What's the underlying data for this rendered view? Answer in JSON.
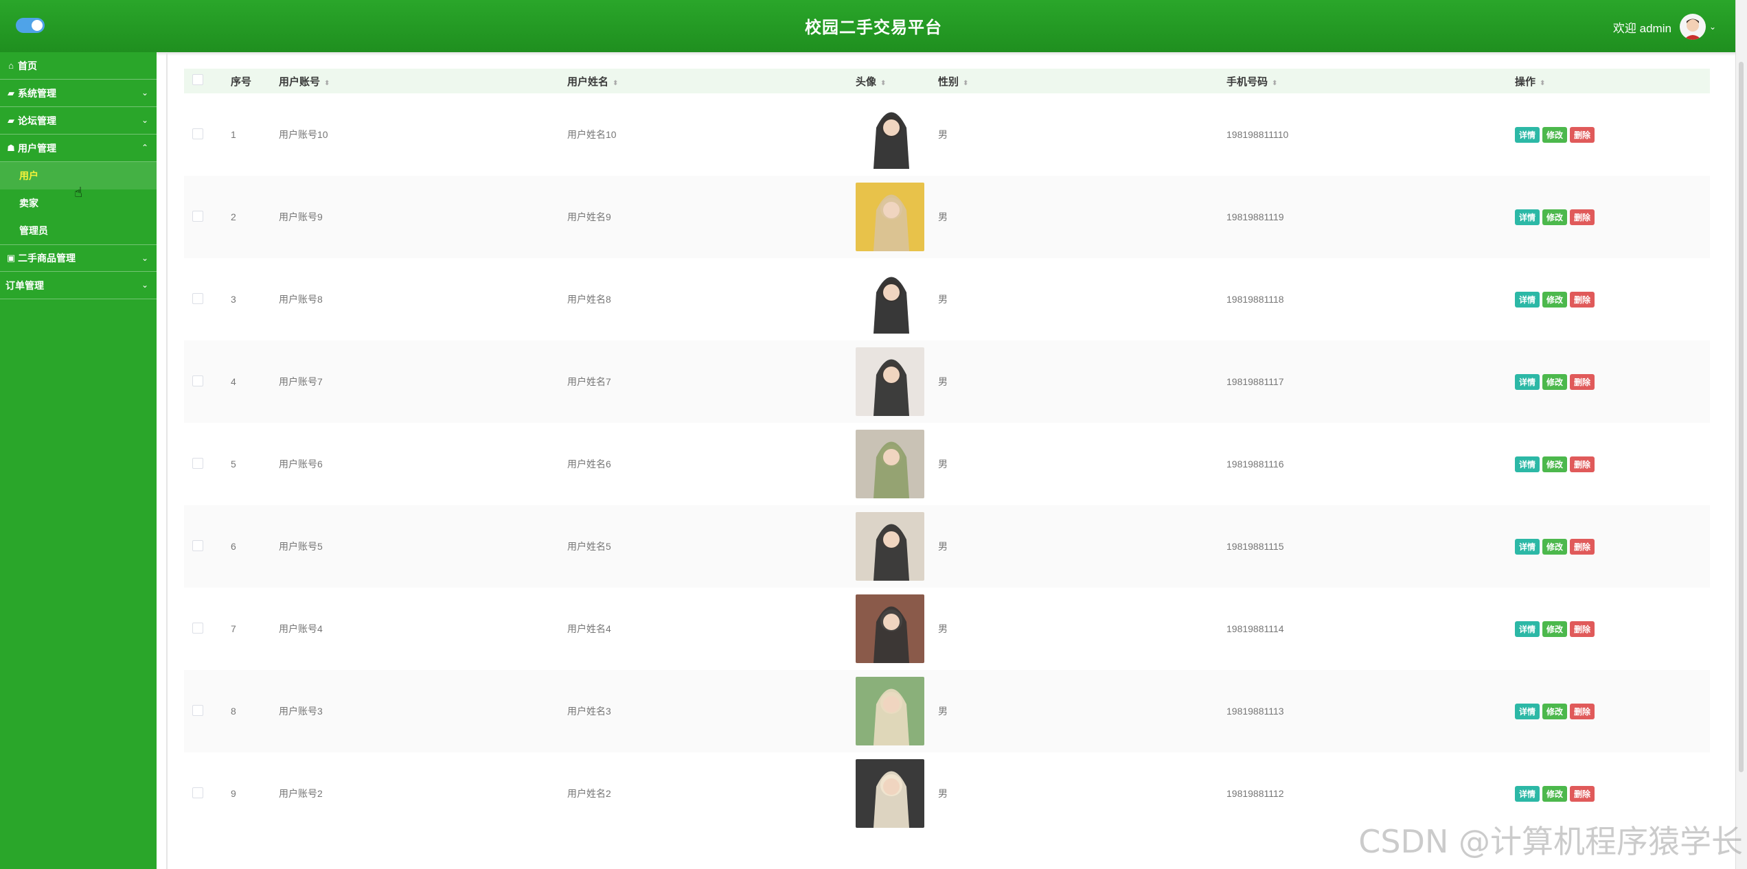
{
  "header": {
    "title": "校园二手交易平台",
    "welcome": "欢迎 admin"
  },
  "sidebar": {
    "items": [
      {
        "label": "首页",
        "icon": "home-icon",
        "expandable": false
      },
      {
        "label": "系统管理",
        "icon": "bank-icon",
        "expandable": true
      },
      {
        "label": "论坛管理",
        "icon": "bank-icon",
        "expandable": true
      },
      {
        "label": "用户管理",
        "icon": "user-icon",
        "expandable": true,
        "expanded": true
      }
    ],
    "sub_items": [
      {
        "label": "用户",
        "active": true
      },
      {
        "label": "卖家",
        "active": false
      },
      {
        "label": "管理员",
        "active": false
      }
    ],
    "items_after": [
      {
        "label": "二手商品管理",
        "icon": "phone-icon",
        "expandable": true
      },
      {
        "label": "订单管理",
        "icon": "",
        "expandable": true
      }
    ]
  },
  "table": {
    "headers": {
      "index": "序号",
      "account": "用户账号",
      "name": "用户姓名",
      "avatar": "头像",
      "gender": "性别",
      "phone": "手机号码",
      "actions": "操作"
    },
    "actions": {
      "detail": "详情",
      "edit": "修改",
      "delete": "删除"
    },
    "rows": [
      {
        "index": "1",
        "account": "用户账号10",
        "name": "用户姓名10",
        "gender": "男",
        "phone": "198198811110"
      },
      {
        "index": "2",
        "account": "用户账号9",
        "name": "用户姓名9",
        "gender": "男",
        "phone": "19819881119"
      },
      {
        "index": "3",
        "account": "用户账号8",
        "name": "用户姓名8",
        "gender": "男",
        "phone": "19819881118"
      },
      {
        "index": "4",
        "account": "用户账号7",
        "name": "用户姓名7",
        "gender": "男",
        "phone": "19819881117"
      },
      {
        "index": "5",
        "account": "用户账号6",
        "name": "用户姓名6",
        "gender": "男",
        "phone": "19819881116"
      },
      {
        "index": "6",
        "account": "用户账号5",
        "name": "用户姓名5",
        "gender": "男",
        "phone": "19819881115"
      },
      {
        "index": "7",
        "account": "用户账号4",
        "name": "用户姓名4",
        "gender": "男",
        "phone": "19819881114"
      },
      {
        "index": "8",
        "account": "用户账号3",
        "name": "用户姓名3",
        "gender": "男",
        "phone": "19819881113"
      },
      {
        "index": "9",
        "account": "用户账号2",
        "name": "用户姓名2",
        "gender": "男",
        "phone": "19819881112"
      }
    ]
  },
  "watermark": "CSDN @计算机程序猿学长",
  "colors": {
    "sidebar": "#2aa62a",
    "header": "#1f8f1f",
    "active_text": "#f5f23a",
    "btn_detail": "#2cb8a6",
    "btn_edit": "#4cb84c",
    "btn_delete": "#e05a5a"
  }
}
